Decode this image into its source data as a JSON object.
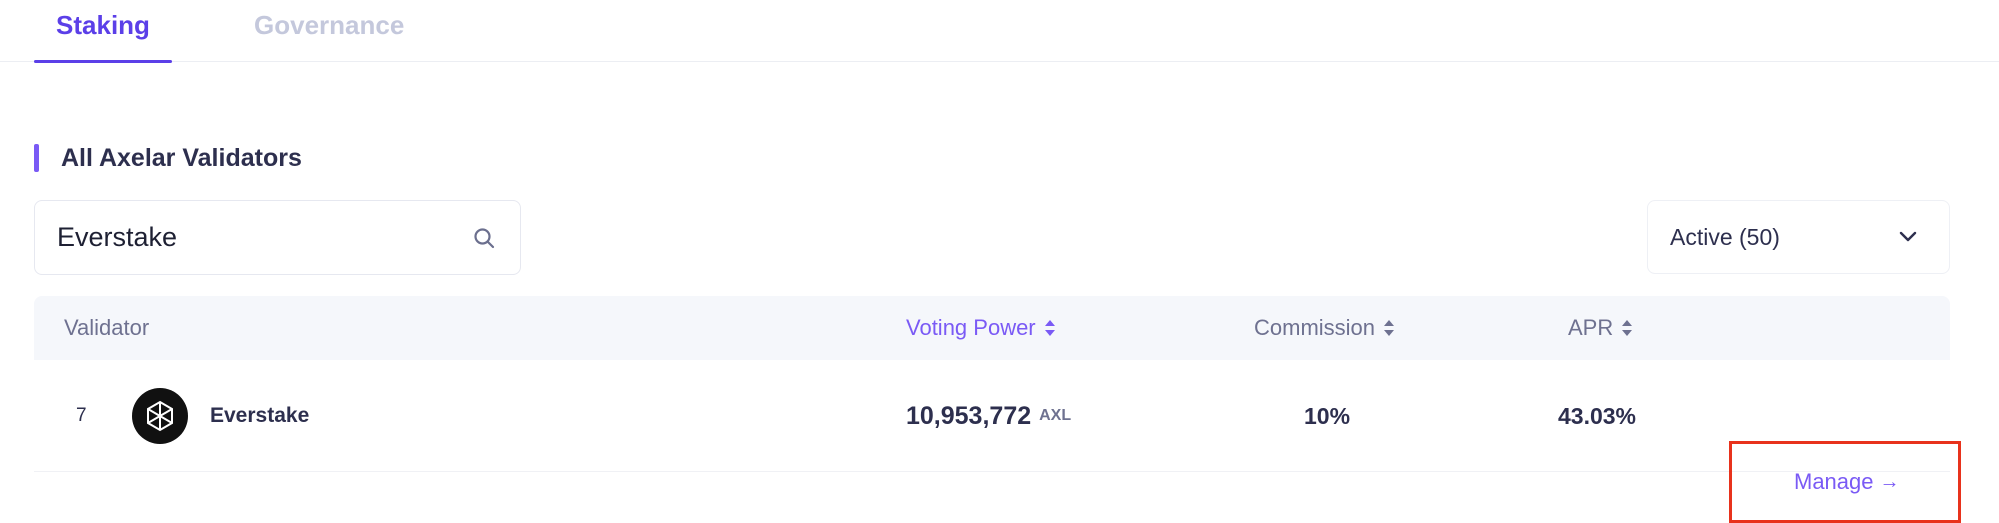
{
  "tabs": {
    "staking": "Staking",
    "governance": "Governance"
  },
  "section": {
    "title": "All Axelar Validators"
  },
  "search": {
    "value": "Everstake",
    "icon": "search-icon"
  },
  "filter": {
    "selected": "Active (50)"
  },
  "table": {
    "headers": {
      "validator": "Validator",
      "voting_power": "Voting Power",
      "commission": "Commission",
      "apr": "APR"
    },
    "rows": [
      {
        "rank": "7",
        "name": "Everstake",
        "voting_power": "10,953,772",
        "unit": "AXL",
        "commission": "10%",
        "apr": "43.03%",
        "action": "Manage"
      }
    ]
  },
  "colors": {
    "accent": "#5b3fe8",
    "accent_light": "#7a5af5",
    "highlight": "#e8321c"
  }
}
